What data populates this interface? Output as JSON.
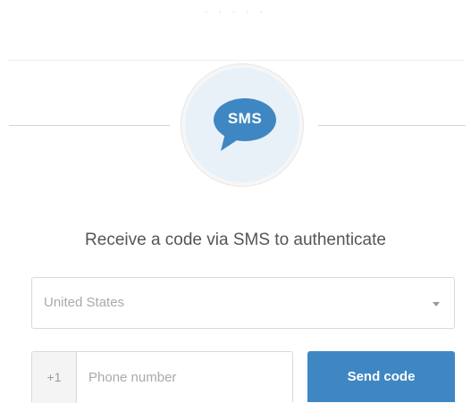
{
  "header": {
    "faint_text": "· · · · ·"
  },
  "sms_icon": {
    "label": "SMS",
    "icon": "speech-bubble-icon",
    "bubble_color": "#3f87c2",
    "circle_color": "#e9f1f8"
  },
  "prompt": "Receive a code via SMS to authenticate",
  "country_select": {
    "selected": "United States",
    "icon": "chevron-down-icon"
  },
  "phone": {
    "prefix": "+1",
    "placeholder": "Phone number",
    "value": ""
  },
  "send_button": {
    "label": "Send code",
    "color": "#3f87c2"
  }
}
